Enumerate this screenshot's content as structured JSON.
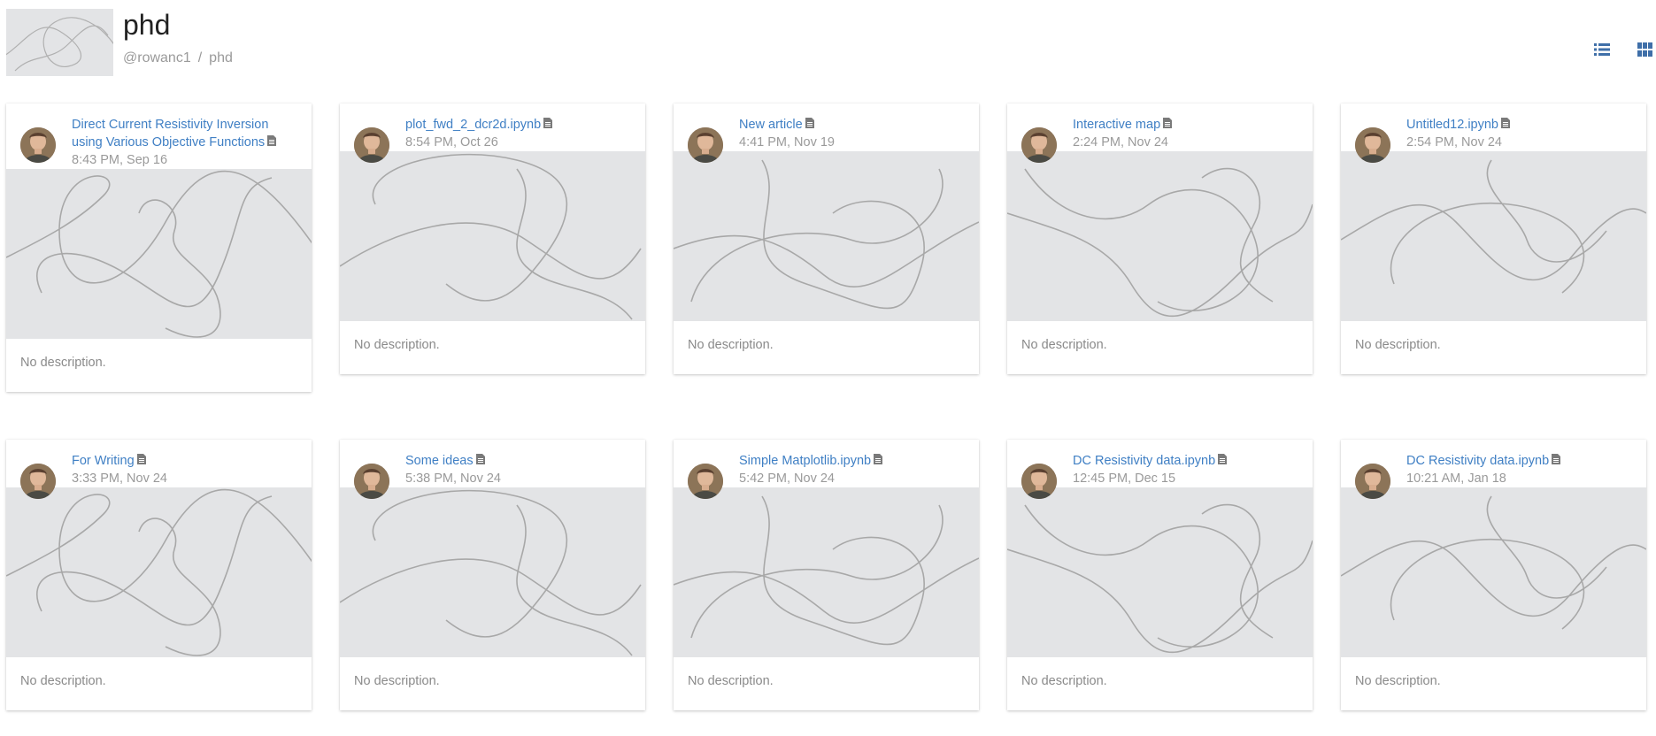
{
  "header": {
    "title": "phd",
    "user": "@rowanc1",
    "separator": "/",
    "project": "phd"
  },
  "toolbar": {
    "list_view_icon": "list-icon",
    "grid_view_icon": "grid-icon",
    "accent_color": "#3f6fa8"
  },
  "cards": [
    {
      "title": "Direct Current Resistivity Inversion using Various Objective Functions",
      "date": "8:43 PM, Sep 16",
      "description": "No description."
    },
    {
      "title": "plot_fwd_2_dcr2d.ipynb",
      "date": "8:54 PM, Oct 26",
      "description": "No description."
    },
    {
      "title": "New article",
      "date": "4:41 PM, Nov 19",
      "description": "No description."
    },
    {
      "title": "Interactive map",
      "date": "2:24 PM, Nov 24",
      "description": "No description."
    },
    {
      "title": "Untitled12.ipynb",
      "date": "2:54 PM, Nov 24",
      "description": "No description."
    },
    {
      "title": "For Writing",
      "date": "3:33 PM, Nov 24",
      "description": "No description."
    },
    {
      "title": "Some ideas",
      "date": "5:38 PM, Nov 24",
      "description": "No description."
    },
    {
      "title": "Simple Matplotlib.ipynb",
      "date": "5:42 PM, Nov 24",
      "description": "No description."
    },
    {
      "title": "DC Resistivity data.ipynb",
      "date": "12:45 PM, Dec 15",
      "description": "No description."
    },
    {
      "title": "DC Resistivity data.ipynb",
      "date": "10:21 AM, Jan 18",
      "description": "No description."
    }
  ],
  "colors": {
    "link": "#3f7fc4",
    "muted": "#9a9a9a",
    "placeholder_bg": "#e3e4e6",
    "placeholder_line": "#a8a8a8"
  }
}
